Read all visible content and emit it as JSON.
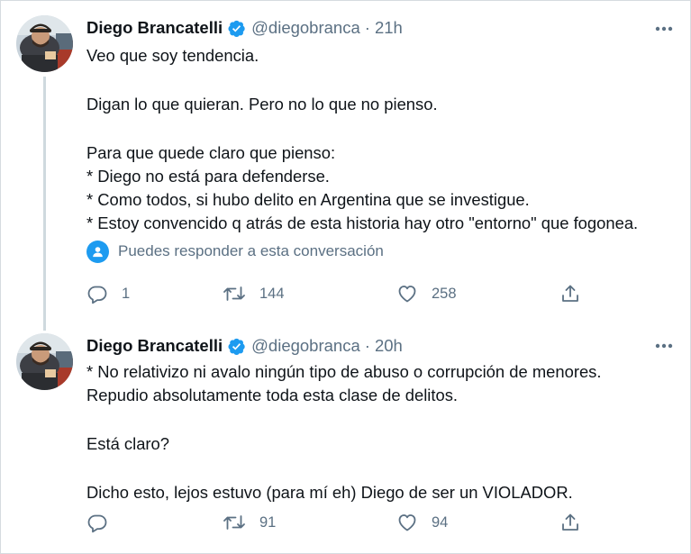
{
  "colors": {
    "accent": "#1d9bf0",
    "secondary_text": "#5b7083",
    "primary_text": "#0f1419"
  },
  "tweets": [
    {
      "author_name": "Diego Brancatelli",
      "handle": "@diegobranca",
      "separator": "·",
      "time": "21h",
      "verified_icon": "verified-badge-icon",
      "lines": [
        "Veo que soy tendencia.",
        "",
        "Digan lo que quieran. Pero no lo que  no pienso.",
        "",
        "Para que quede claro que pienso:",
        "* Diego no está para defenderse.",
        "* Como todos, si hubo delito en Argentina que se investigue.",
        "* Estoy convencido q atrás de esta historia hay otro \"entorno\" que fogonea."
      ],
      "reply_notice": "Puedes responder a esta conversación",
      "reply_count": "1",
      "retweet_count": "144",
      "like_count": "258"
    },
    {
      "author_name": "Diego Brancatelli",
      "handle": "@diegobranca",
      "separator": "·",
      "time": "20h",
      "verified_icon": "verified-badge-icon",
      "lines": [
        "* No relativizo ni avalo ningún tipo de abuso o corrupción de menores.",
        "Repudio absolutamente toda esta clase de delitos.",
        "",
        "Está claro?",
        "",
        "Dicho esto, lejos estuvo (para mí eh) Diego de ser un VIOLADOR."
      ],
      "reply_count": "",
      "retweet_count": "91",
      "like_count": "94"
    }
  ]
}
